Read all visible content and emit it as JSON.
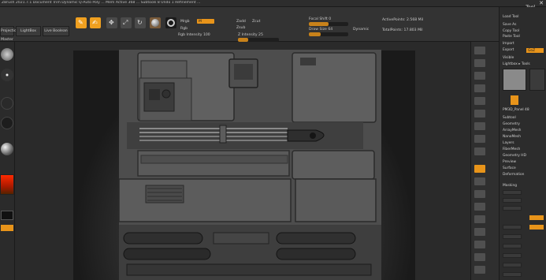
{
  "menu": {
    "title": "ZBrush 2021.7.1  Document  Trim Dynamic  Q-Auto  Poly ...  Mem  Active 368 ...  Subtools 8  Undo 1  Refinement  ...",
    "items": [
      "Alpha",
      "Brush",
      "Color",
      "Document",
      "Draw",
      "Edit",
      "File",
      "Layer",
      "Light",
      "Macro",
      "Marker",
      "Material",
      "Movie",
      "Picker",
      "Preferences",
      "Render",
      "Stencil",
      "Stroke",
      "Texture",
      "Tool",
      "Transform",
      "Zplugin",
      "Zscript"
    ],
    "tool_label": "Tool"
  },
  "toolbar": {
    "tabs": [
      "Projection Master",
      "LightBox",
      "Live Boolean"
    ],
    "edit_label": "Edit",
    "draw_label": "Draw",
    "move_label": "Move",
    "scale_label": "Scale",
    "rotate_label": "Rotate",
    "mrgb_label": "Mrgb",
    "rgb_label": "Rgb",
    "m_label": "M",
    "zadd_label": "Zadd",
    "zsub_label": "Zsub",
    "zcut_label": "Zcut",
    "focal_shift_label": "Focal Shift 0",
    "draw_size_label": "Draw Size 64",
    "dynamic_label": "Dynamic",
    "rgb_intensity_label": "Rgb Intensity 100",
    "z_intensity_label": "Z Intensity 25",
    "active_points_label": "ActivePoints: 2.568 Mil",
    "total_points_label": "TotalPoints: 17.803 Mil"
  },
  "right_panel": {
    "load_tool": "Load Tool",
    "save_as": "Save As",
    "copy_tool": "Copy Tool",
    "paste_tool": "Paste Tool",
    "import": "Import",
    "export": "Export",
    "clone": "Clone",
    "make_polymesh": "Make PolyMesh3D",
    "goz": "GoZ",
    "all": "All",
    "visible": "Visible",
    "lightbox_tools": "Lightbox ▸ Tools",
    "panel_item": "PM3D_Panel 48",
    "sections": [
      "Subtool",
      "Geometry",
      "ArrayMesh",
      "NanoMesh",
      "Layers",
      "FiberMesh",
      "Geometry HD",
      "Preview",
      "Surface",
      "Deformation",
      "Masking",
      "Visibility",
      "Polygroups",
      "Contact",
      "Morph Target",
      "Polypaint",
      "UV Map",
      "Texture Map",
      "Displacement Map",
      "Normal Map",
      "Vector Displacement Map",
      "Display Properties",
      "Unified Skin",
      "Initialize",
      "Import",
      "Export"
    ]
  },
  "shelf": {
    "labels": [
      "BPR",
      "SPix 3",
      "Scroll",
      "Zoom",
      "Actual",
      "AAHalf",
      "Persp",
      "Floor",
      "Local",
      "Frame",
      "Move",
      "Scale",
      "Rotate",
      "Line Fill",
      "PolyF",
      "Transp",
      "Ghost",
      "Solo",
      "Xpose"
    ]
  },
  "colors": {
    "accent": "#e8941a",
    "panel": "#333333",
    "bg": "#262626",
    "canvas": "#5b5b5b"
  },
  "icons": [
    "close-icon",
    "edit-icon",
    "draw-icon",
    "move-icon",
    "scale-icon",
    "rotate-icon",
    "sphere-icon",
    "brush-icon",
    "stroke-icon",
    "alpha-icon",
    "texture-icon",
    "material-icon",
    "color-picker-icon",
    "tool-thumbnail-icon"
  ]
}
